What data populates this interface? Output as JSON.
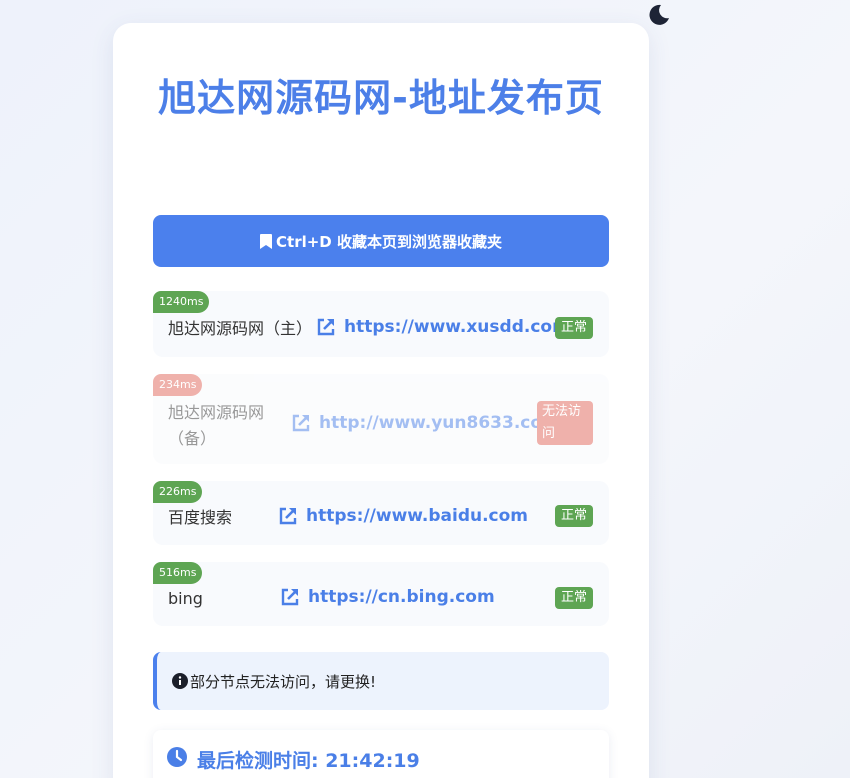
{
  "page": {
    "title": "旭达网源码网-地址发布页",
    "bookmark_label": "Ctrl+D 收藏本页到浏览器收藏夹",
    "notice": "部分节点无法访问，请更换!",
    "last_check_label": "最后检测时间: 21:42:19"
  },
  "links": [
    {
      "latency": "1240ms",
      "name": "旭达网源码网（主）",
      "url": "https://www.xusdd.com",
      "status": "正常",
      "ok": true
    },
    {
      "latency": "234ms",
      "name": "旭达网源码网（备）",
      "url": "http://www.yun8633.com",
      "status": "无法访问",
      "ok": false
    },
    {
      "latency": "226ms",
      "name": "百度搜索",
      "url": "https://www.baidu.com",
      "status": "正常",
      "ok": true
    },
    {
      "latency": "516ms",
      "name": "bing",
      "url": "https://cn.bing.com",
      "status": "正常",
      "ok": true
    }
  ],
  "icons": {
    "theme": "moon-icon",
    "bookmark": "bookmark-icon",
    "link": "external-link-icon",
    "info": "info-circle-icon",
    "clock": "clock-icon"
  },
  "colors": {
    "accent": "#4b80ed",
    "ok": "#5ea553",
    "error": "#e0655a"
  }
}
